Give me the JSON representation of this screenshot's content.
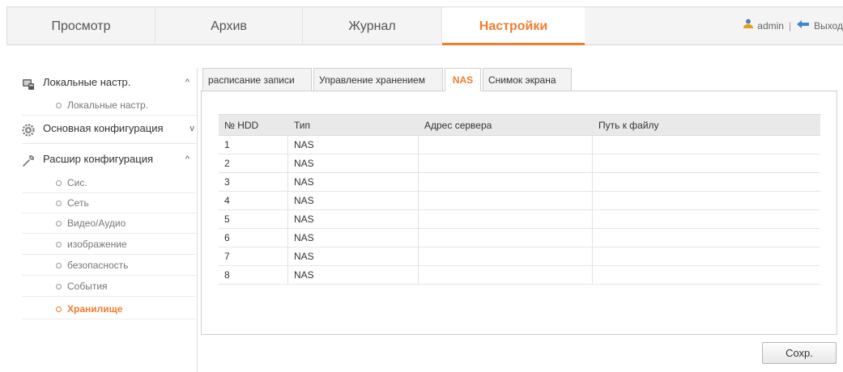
{
  "nav": {
    "tabs": [
      {
        "label": "Просмотр",
        "active": false
      },
      {
        "label": "Архив",
        "active": false
      },
      {
        "label": "Журнал",
        "active": false
      },
      {
        "label": "Настройки",
        "active": true
      }
    ],
    "user": "admin",
    "separator": "|",
    "logout": "Выход"
  },
  "sidebar": {
    "sections": [
      {
        "label": "Локальные настр.",
        "icon": "monitor-icon",
        "caret": "^",
        "items": [
          {
            "label": "Локальные настр."
          }
        ]
      },
      {
        "label": "Основная конфигурация",
        "icon": "gear-icon",
        "caret": "v",
        "items": []
      },
      {
        "label": "Расшир конфигурация",
        "icon": "wrench-icon",
        "caret": "^",
        "items": [
          {
            "label": "Сис."
          },
          {
            "label": "Сеть"
          },
          {
            "label": "Видео/Аудио"
          },
          {
            "label": "изображение"
          },
          {
            "label": "безопасность"
          },
          {
            "label": "События"
          },
          {
            "label": "Хранилище",
            "active": true
          }
        ]
      }
    ]
  },
  "tabs": [
    {
      "label": "расписание записи"
    },
    {
      "label": "Управление хранением"
    },
    {
      "label": "NAS",
      "active": true
    },
    {
      "label": "Снимок экрана"
    }
  ],
  "table": {
    "columns": [
      "№ HDD",
      "Тип",
      "Адрес сервера",
      "Путь к файлу"
    ],
    "rows": [
      [
        "1",
        "NAS",
        "",
        ""
      ],
      [
        "2",
        "NAS",
        "",
        ""
      ],
      [
        "3",
        "NAS",
        "",
        ""
      ],
      [
        "4",
        "NAS",
        "",
        ""
      ],
      [
        "5",
        "NAS",
        "",
        ""
      ],
      [
        "6",
        "NAS",
        "",
        ""
      ],
      [
        "7",
        "NAS",
        "",
        ""
      ],
      [
        "8",
        "NAS",
        "",
        ""
      ]
    ]
  },
  "save_label": "Сохр.",
  "colors": {
    "accent": "#f07d32",
    "header_bg": "#f4f4f4",
    "table_header_bg": "#e9e9e9"
  }
}
